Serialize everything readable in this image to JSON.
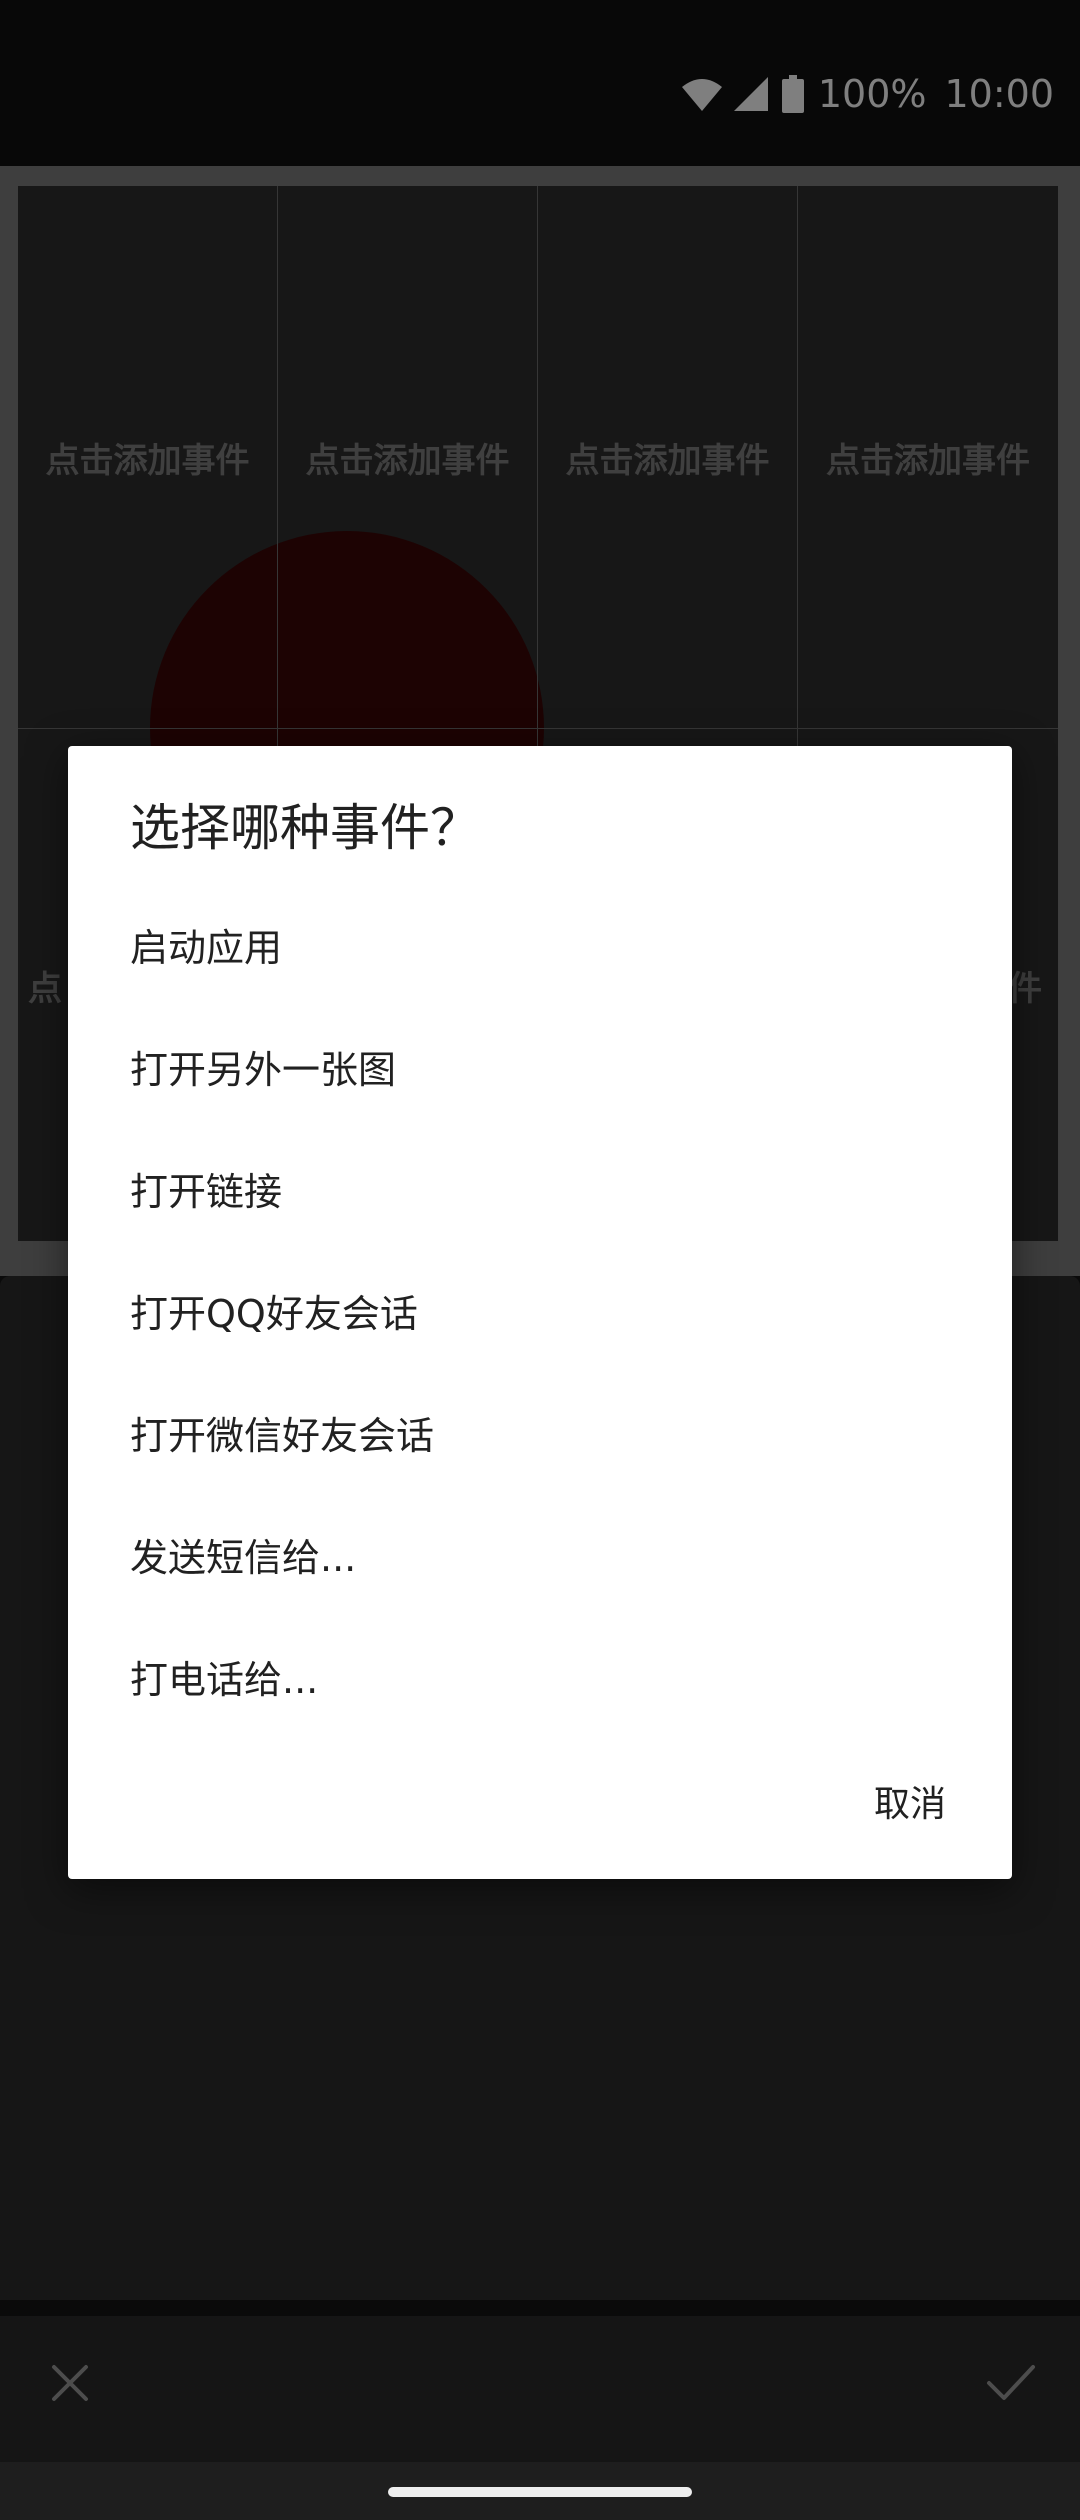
{
  "status_bar": {
    "battery_percent": "100%",
    "time": "10:00",
    "icons": [
      "wifi-icon",
      "cell-signal-icon",
      "battery-icon"
    ]
  },
  "grid": {
    "cell_label": "点击添加事件",
    "row1": [
      "点击添加事件",
      "点击添加事件",
      "点击添加事件",
      "点击添加事件"
    ],
    "row2_left_partial": "点",
    "row2_right_partial": "件"
  },
  "dialog": {
    "title": "选择哪种事件？",
    "items": [
      "启动应用",
      "打开另外一张图",
      "打开链接",
      "打开QQ好友会话",
      "打开微信好友会话",
      "发送短信给...",
      "打电话给..."
    ],
    "cancel_label": "取消"
  },
  "bottom_bar": {
    "icons": [
      "close-icon",
      "check-icon"
    ]
  },
  "colors": {
    "dialog_background": "#ffffff",
    "scrim": "rgba(0,0,0,0.5)",
    "grid_text": "#7e7e7e",
    "circle": "#3b0707"
  }
}
